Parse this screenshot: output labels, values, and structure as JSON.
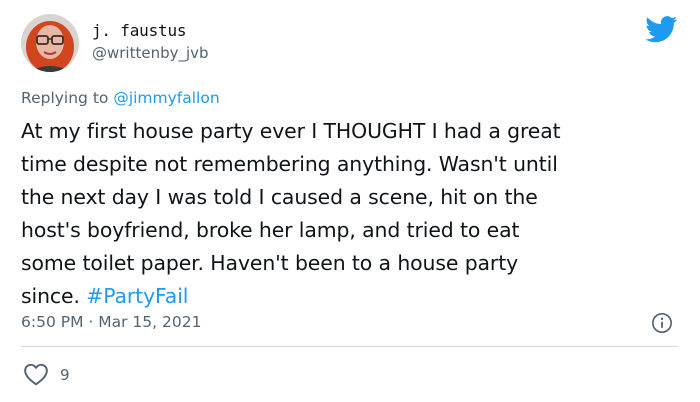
{
  "author": {
    "display_name": "j. faustus",
    "handle": "@writtenby_jvb"
  },
  "reply": {
    "prefix": "Replying to ",
    "to": "@jimmyfallon"
  },
  "tweet": {
    "lines": [
      "At my first house party ever I THOUGHT I had a great",
      "time despite not remembering anything. Wasn't until",
      "the next day I was told I caused a scene, hit on the",
      "host's boyfriend, broke her lamp, and tried to eat",
      "some toilet paper. Haven't been to a house party",
      "since. "
    ],
    "hashtag": "#PartyFail"
  },
  "meta": {
    "time": "6:50 PM",
    "separator": " · ",
    "date": "Mar 15, 2021"
  },
  "stats": {
    "likes": "9"
  },
  "icons": {
    "brand": "twitter-bird-icon",
    "info": "info-icon",
    "like": "heart-icon"
  },
  "colors": {
    "accent": "#1d9bf0",
    "secondary_text": "#536471",
    "divider": "#cfd9de"
  }
}
